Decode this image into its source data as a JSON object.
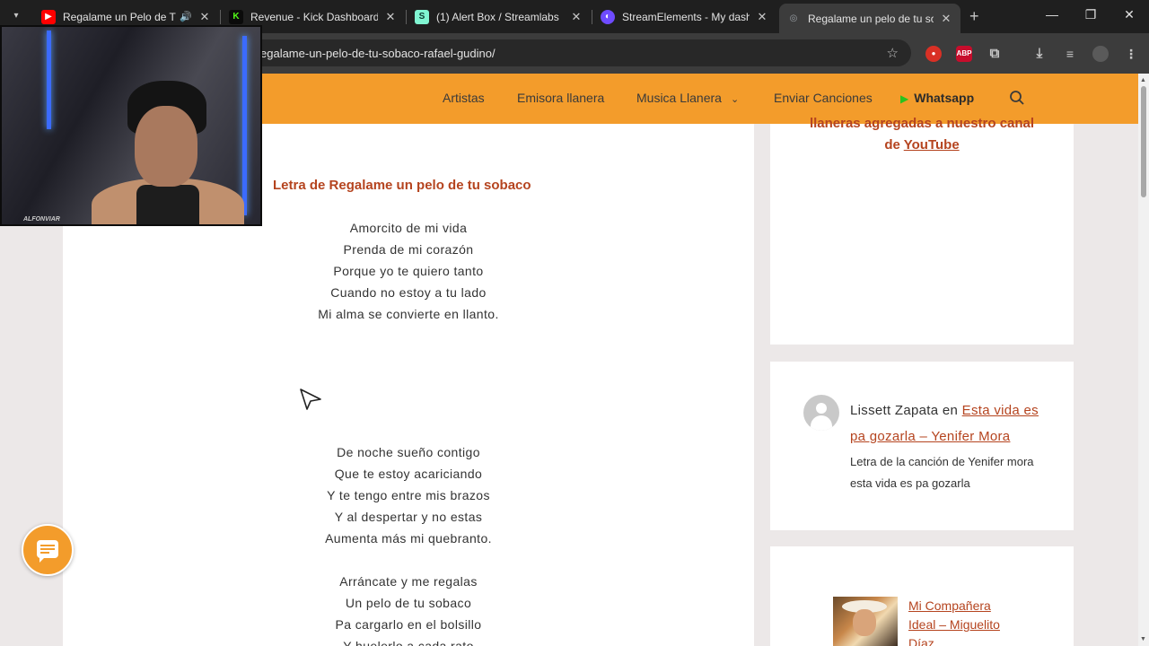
{
  "browser": {
    "tabs": [
      {
        "title": "Regalame un Pelo de Tu",
        "favicon_color": "#ff0000",
        "active": false
      },
      {
        "title": "Revenue - Kick Dashboard",
        "favicon_color": "#53fc18",
        "active": false
      },
      {
        "title": "(1) Alert Box / Streamlabs",
        "favicon_color": "#80f5d2",
        "active": false
      },
      {
        "title": "StreamElements - My dashb",
        "favicon_color": "#6e4bff",
        "active": false
      },
      {
        "title": "Regalame un pelo de tu sob",
        "favicon_color": "#9aa0a6",
        "active": true
      }
    ],
    "url": "egalame-un-pelo-de-tu-sobaco-rafael-gudino/",
    "extensions": [
      {
        "name": "red-ext",
        "label": "",
        "color": "#d93025"
      },
      {
        "name": "adblock-plus",
        "label": "ABP",
        "color": "#c70d2c"
      }
    ]
  },
  "site": {
    "nav": {
      "items": [
        "Artistas",
        "Emisora llanera",
        "Musica Llanera",
        "Enviar Canciones"
      ],
      "whatsapp": "Whatsapp",
      "accent_color": "#f39c2b"
    },
    "article": {
      "lyrics_title": "Letra de Regalame un pelo de tu sobaco",
      "stanza1": [
        "Amorcito de mi vida",
        "Prenda de mi corazón",
        "Porque yo te quiero tanto",
        "Cuando no estoy a tu lado",
        "Mi alma se convierte en llanto."
      ],
      "stanza2": [
        "De noche sueño contigo",
        "Que te estoy acariciando",
        "Y te tengo entre mis brazos",
        "Y al despertar y no estas",
        "Aumenta más mi quebranto."
      ],
      "stanza3": [
        "Arráncate y me regalas",
        "Un pelo de tu sobaco",
        "Pa cargarlo en el bolsillo",
        "Y huelerlo a cada rato"
      ]
    },
    "sidebar": {
      "widget1": {
        "line1": "llaneras agregadas a nuestro canal",
        "prefix": "de ",
        "link": "YouTube"
      },
      "comment": {
        "author": "Lissett Zapata",
        "connector": "en",
        "link": "Esta vida es pa gozarla – Yenifer Mora",
        "excerpt": "Letra de la canción de Yenifer mora esta vida es pa gozarla"
      },
      "post": {
        "title": "Mi Compañera Ideal – Miguelito Díaz"
      }
    }
  },
  "overlay": {
    "webcam_tag": "ALFONVIAR"
  }
}
